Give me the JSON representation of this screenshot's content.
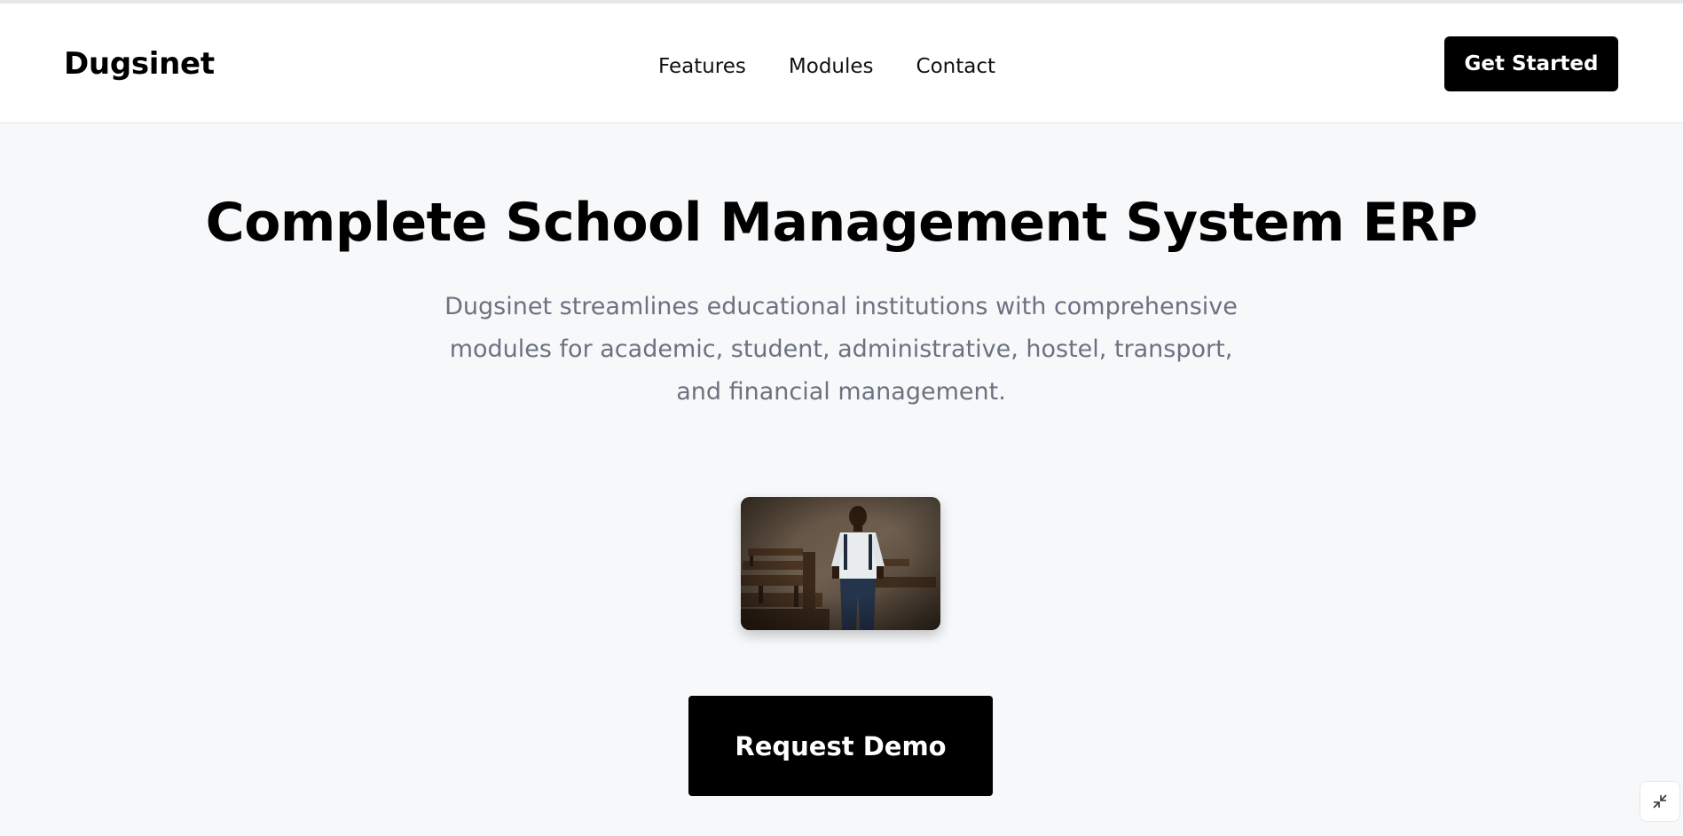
{
  "nav": {
    "brand": "Dugsinet",
    "links": [
      "Features",
      "Modules",
      "Contact"
    ],
    "cta": "Get Started"
  },
  "hero": {
    "title": "Complete School Management System ERP",
    "subtitle": "Dugsinet streamlines educational institutions with comprehensive modules for academic, student, administrative, hostel, transport, and financial management.",
    "image": "photo of a student standing in a classroom",
    "cta": "Request Demo"
  },
  "corner_button_icon": "minimize-icon",
  "colors": {
    "primary": "#000000",
    "background": "#f7f8fa",
    "muted_text": "#6b7280",
    "header_bg": "#ffffff"
  }
}
